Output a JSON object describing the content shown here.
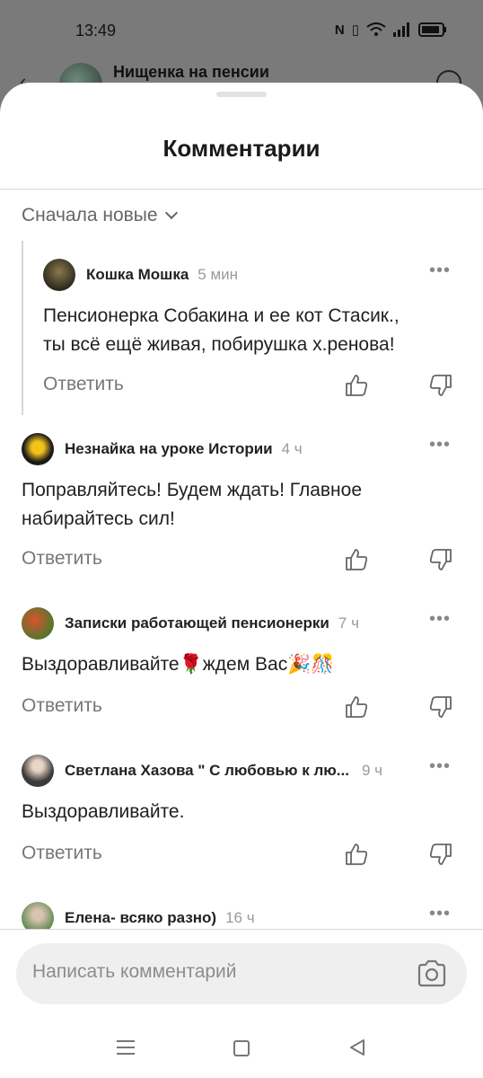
{
  "status": {
    "time": "13:49"
  },
  "background": {
    "channel_title": "Нищенка на пенсии"
  },
  "sheet": {
    "title": "Комментарии",
    "sort_label": "Сначала новые"
  },
  "comments": [
    {
      "author": "Кошка Мошка",
      "time": "5 мин",
      "text_lines": [
        "Пенсионерка Собакина и ее кот Стасик.,",
        "ты всё ещё живая, побирушка х.ренова!"
      ],
      "reply": "Ответить"
    },
    {
      "author": "Незнайка на уроке Истории",
      "time": "4 ч",
      "text_lines": [
        "Поправляйтесь! Будем ждать! Главное",
        "набирайтесь сил!"
      ],
      "reply": "Ответить"
    },
    {
      "author": "Записки работающей пенсионерки",
      "time": "7 ч",
      "text_lines": [
        "Выздоравливайте🌹ждем Вас🎉🎊"
      ],
      "reply": "Ответить"
    },
    {
      "author": "Светлана Хазова  \" С любовью к лю...",
      "time": "9 ч",
      "text_lines": [
        "Выздоравливайте."
      ],
      "reply": "Ответить"
    },
    {
      "author": "Елена- всяко разно)",
      "time": "16 ч",
      "text_lines": [],
      "reply": ""
    }
  ],
  "input": {
    "placeholder": "Написать комментарий"
  },
  "icons": {
    "more": "more-dots-icon",
    "like": "thumbs-up-icon",
    "dislike": "thumbs-down-icon",
    "camera": "camera-icon"
  }
}
